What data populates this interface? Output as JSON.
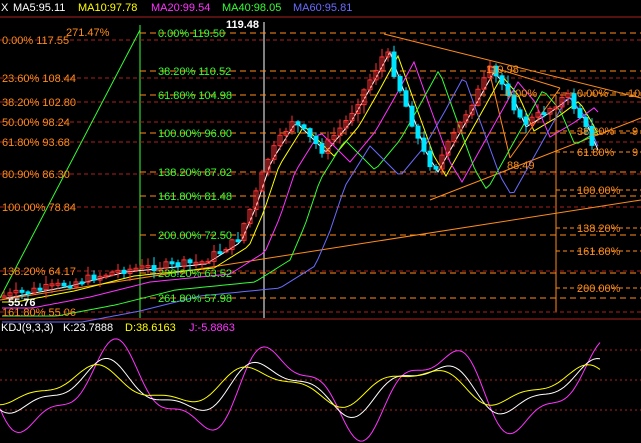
{
  "colors": {
    "background": "#000000",
    "up": "#ff3232",
    "down": "#00e5ff",
    "fib_left": "#ff8c1a",
    "fib_right": "#ff8c1a",
    "fib_mid": "#33ff33",
    "ma5": "#ffffff",
    "ma10": "#ffff00",
    "ma20": "#ff33ff",
    "ma40": "#33ff33",
    "ma60": "#6b6bff",
    "grid": "#aa1f1f"
  },
  "header": {
    "close_icon": "X",
    "ma5": "MA5:95.11",
    "ma10": "MA10:97.78",
    "ma20": "MA20:99.54",
    "ma40": "MA40:98.05",
    "ma60": "MA60:95.81"
  },
  "price_labels": {
    "high": "119.48",
    "peak2": "110.98",
    "low2": "88.49",
    "low": "55.76"
  },
  "fib_left": [
    {
      "text": "0.00% 117.55"
    },
    {
      "text": "23.60% 108.44"
    },
    {
      "text": "38.20% 102.80"
    },
    {
      "text": "50.00% 98.24"
    },
    {
      "text": "61.80% 93.68"
    },
    {
      "text": "80.90% 86.30"
    },
    {
      "text": "100.00% 78.84"
    },
    {
      "text": "138.20% 64.17"
    },
    {
      "text": "161.80% 55.06"
    }
  ],
  "fib_left_extra": "271.47%",
  "fib_mid": [
    {
      "text": "0.00%   119.50"
    },
    {
      "text": "38.20%   110.52"
    },
    {
      "text": "61.80%   104.98"
    },
    {
      "text": "100.00%   96.00"
    },
    {
      "text": "138.20%   87.02"
    },
    {
      "text": "161.80%   81.48"
    },
    {
      "text": "200.00%   72.50"
    },
    {
      "text": "238.20%   63.52"
    },
    {
      "text": "261.80%   57.98"
    }
  ],
  "fib_right": [
    {
      "text": "0.00%"
    },
    {
      "text": "38.20%"
    },
    {
      "text": "61.80%"
    },
    {
      "text": "100.00%"
    },
    {
      "text": "138.20%"
    },
    {
      "text": "161.80%"
    },
    {
      "text": "200.00%"
    }
  ],
  "fib_right_inline": "0.00%",
  "edge_labels": {
    "e1": "10",
    "e2": "9",
    "e3": "9"
  },
  "kdj": {
    "title": "KDJ(9,3,3)",
    "k": "K:23.7888",
    "d": "D:38.6163",
    "j": "J:-5.8863"
  }
}
